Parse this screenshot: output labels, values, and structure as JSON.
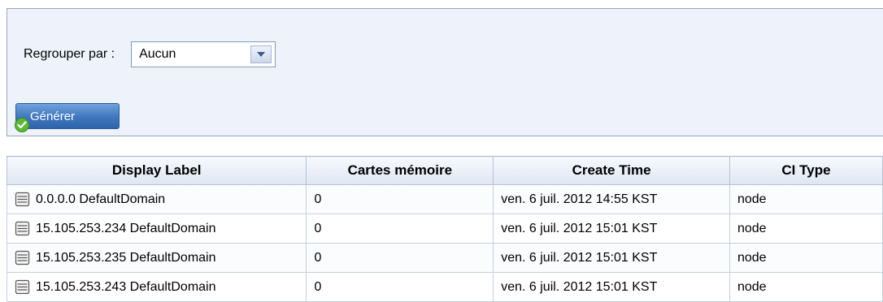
{
  "filter": {
    "group_by_label": "Regrouper par :",
    "group_by_value": "Aucun",
    "generate_label": "Générer"
  },
  "table": {
    "columns": [
      "Display Label",
      "Cartes mémoire",
      "Create Time",
      "CI Type"
    ],
    "rows": [
      {
        "label": "0.0.0.0 DefaultDomain",
        "memory_cards": "0",
        "create_time": "ven. 6 juil. 2012 14:55 KST",
        "ci_type": "node"
      },
      {
        "label": "15.105.253.234 DefaultDomain",
        "memory_cards": "0",
        "create_time": "ven. 6 juil. 2012 15:01 KST",
        "ci_type": "node"
      },
      {
        "label": "15.105.253.235 DefaultDomain",
        "memory_cards": "0",
        "create_time": "ven. 6 juil. 2012 15:01 KST",
        "ci_type": "node"
      },
      {
        "label": "15.105.253.243 DefaultDomain",
        "memory_cards": "0",
        "create_time": "ven. 6 juil. 2012 15:01 KST",
        "ci_type": "node"
      }
    ]
  },
  "icons": {
    "row_icon": "server-icon",
    "dropdown_icon": "chevron-down-icon",
    "generate_icon": "check-icon"
  }
}
